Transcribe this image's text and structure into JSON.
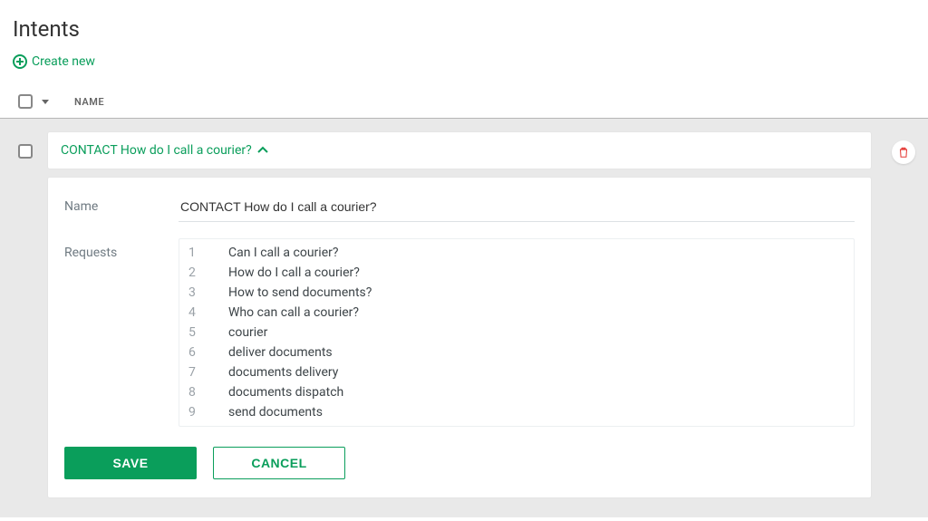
{
  "page": {
    "title": "Intents"
  },
  "actions": {
    "create_new_label": "Create new"
  },
  "table": {
    "name_header": "NAME"
  },
  "intent": {
    "header_title": "CONTACT How do I call a courier?",
    "labels": {
      "name": "Name",
      "requests": "Requests"
    },
    "name_value": "CONTACT How do I call a courier?",
    "requests": [
      {
        "n": "1",
        "text": "Can I call a courier?"
      },
      {
        "n": "2",
        "text": "How do I call a courier?"
      },
      {
        "n": "3",
        "text": "How to send documents?"
      },
      {
        "n": "4",
        "text": "Who can call a courier?"
      },
      {
        "n": "5",
        "text": "courier"
      },
      {
        "n": "6",
        "text": "deliver documents"
      },
      {
        "n": "7",
        "text": "documents delivery"
      },
      {
        "n": "8",
        "text": "documents dispatch"
      },
      {
        "n": "9",
        "text": "send documents"
      }
    ]
  },
  "buttons": {
    "save": "SAVE",
    "cancel": "CANCEL"
  },
  "colors": {
    "accent": "#0a9e5b",
    "danger": "#e53935"
  }
}
